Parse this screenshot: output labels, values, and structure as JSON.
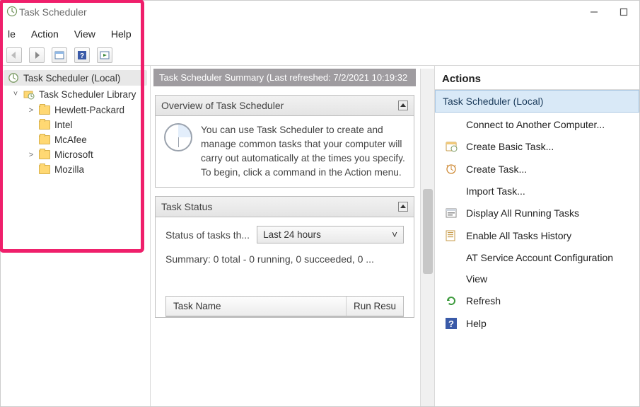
{
  "window": {
    "title": "Task Scheduler"
  },
  "menubar": {
    "left_cut": "le",
    "items": [
      "Action",
      "View",
      "Help"
    ]
  },
  "tree": {
    "root": "Task Scheduler (Local)",
    "library": "Task Scheduler Library",
    "children": [
      {
        "label": "Hewlett-Packard",
        "expandable": true
      },
      {
        "label": "Intel",
        "expandable": false
      },
      {
        "label": "McAfee",
        "expandable": false
      },
      {
        "label": "Microsoft",
        "expandable": true
      },
      {
        "label": "Mozilla",
        "expandable": false
      }
    ]
  },
  "center": {
    "title": "Task Scheduler Summary (Last refreshed: 7/2/2021 10:19:32",
    "overview": {
      "header": "Overview of Task Scheduler",
      "body": "You can use Task Scheduler to create and manage common tasks that your computer will carry out automatically at the times you specify. To begin, click a command in the Action menu."
    },
    "status": {
      "header": "Task Status",
      "label": "Status of tasks th...",
      "dropdown": "Last 24 hours",
      "summary": "Summary: 0 total - 0 running, 0 succeeded, 0 ...",
      "table": {
        "col1": "Task Name",
        "col2": "Run Resu"
      }
    }
  },
  "actions": {
    "title": "Actions",
    "group": "Task Scheduler (Local)",
    "items": [
      {
        "id": "connect",
        "label": "Connect to Another Computer...",
        "icon": "blank"
      },
      {
        "id": "basic",
        "label": "Create Basic Task...",
        "icon": "basic-task"
      },
      {
        "id": "create",
        "label": "Create Task...",
        "icon": "create-task"
      },
      {
        "id": "import",
        "label": "Import Task...",
        "icon": "blank"
      },
      {
        "id": "running",
        "label": "Display All Running Tasks",
        "icon": "running"
      },
      {
        "id": "history",
        "label": "Enable All Tasks History",
        "icon": "history"
      },
      {
        "id": "atsvc",
        "label": "AT Service Account Configuration",
        "icon": "blank"
      },
      {
        "id": "view",
        "label": "View",
        "icon": "blank"
      },
      {
        "id": "refresh",
        "label": "Refresh",
        "icon": "refresh"
      },
      {
        "id": "help",
        "label": "Help",
        "icon": "help"
      }
    ]
  }
}
